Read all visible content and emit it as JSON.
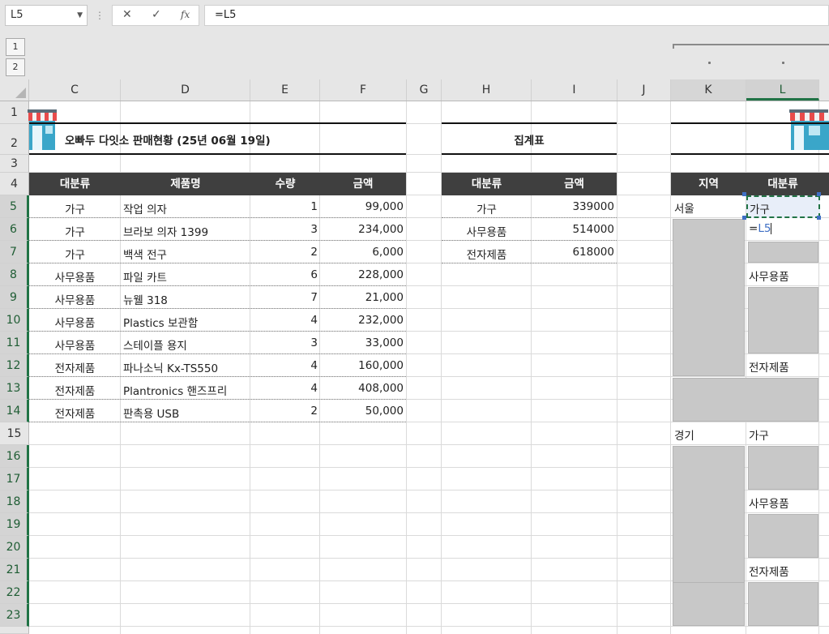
{
  "formula_bar": {
    "name_box": "L5",
    "cancel_icon": "✕",
    "enter_icon": "✓",
    "fx_label": "fx",
    "formula": "=L5"
  },
  "outline": {
    "levels": [
      "1",
      "2"
    ]
  },
  "columns": [
    "C",
    "D",
    "E",
    "F",
    "G",
    "H",
    "I",
    "J",
    "K",
    "L"
  ],
  "rows": [
    "1",
    "2",
    "3",
    "4",
    "5",
    "6",
    "7",
    "8",
    "9",
    "10",
    "11",
    "12",
    "13",
    "14",
    "15",
    "16",
    "17",
    "18",
    "19",
    "20",
    "21",
    "22",
    "23"
  ],
  "selected": {
    "column": "L",
    "row": "5"
  },
  "sales_table": {
    "title": "오빠두 다잇소 판매현황 (25년 06월 19일)",
    "headers": [
      "대분류",
      "제품명",
      "수량",
      "금액"
    ],
    "rows": [
      [
        "가구",
        "작업 의자",
        "1",
        "99,000"
      ],
      [
        "가구",
        "브라보 의자 1399",
        "3",
        "234,000"
      ],
      [
        "가구",
        "백색 전구",
        "2",
        "6,000"
      ],
      [
        "사무용품",
        "파일 카트",
        "6",
        "228,000"
      ],
      [
        "사무용품",
        "뉴웰 318",
        "7",
        "21,000"
      ],
      [
        "사무용품",
        "Plastics 보관함",
        "4",
        "232,000"
      ],
      [
        "사무용품",
        "스테이플 용지",
        "3",
        "33,000"
      ],
      [
        "전자제품",
        "파나소닉 Kx-TS550",
        "4",
        "160,000"
      ],
      [
        "전자제품",
        "Plantronics 핸즈프리",
        "4",
        "408,000"
      ],
      [
        "전자제품",
        "판촉용 USB",
        "2",
        "50,000"
      ]
    ]
  },
  "summary_table": {
    "title": "집계표",
    "headers": [
      "대분류",
      "금액"
    ],
    "rows": [
      [
        "가구",
        "339000"
      ],
      [
        "사무용품",
        "514000"
      ],
      [
        "전자제품",
        "618000"
      ]
    ]
  },
  "region_table": {
    "headers": [
      "지역",
      "대분류"
    ],
    "region1": "서울",
    "region2": "경기",
    "l5": "가구",
    "l6_edit_prefix": "=",
    "l6_edit_ref": "L5",
    "l8": "사무용품",
    "l12": "전자제품",
    "l15": "가구",
    "l18": "사무용품",
    "l21": "전자제품"
  },
  "colors": {
    "accent": "#217346",
    "header_bg": "#3f3f3f",
    "gray_fill": "#c8c8c8",
    "ref_blue": "#3f6fc4"
  },
  "icons": [
    "shop-awning-icon",
    "chevron-down-icon",
    "vertical-dots-icon"
  ]
}
